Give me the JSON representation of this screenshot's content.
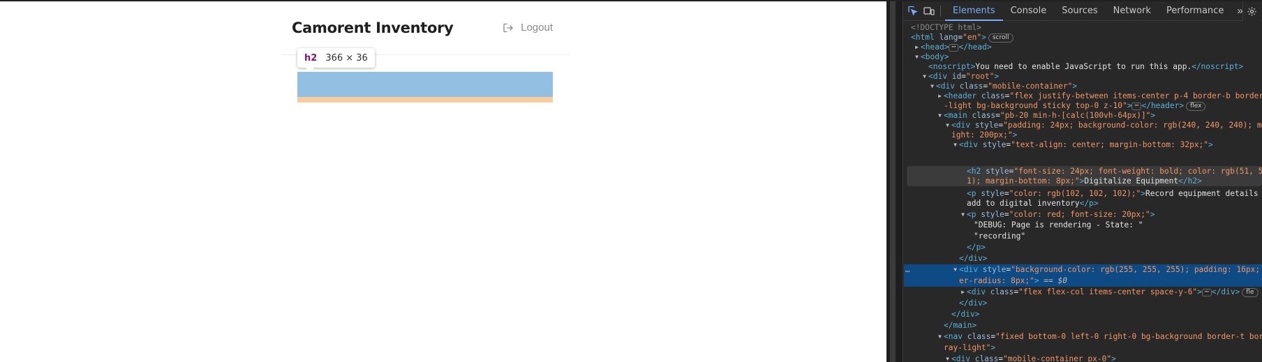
{
  "app": {
    "title": "Camorent Inventory",
    "logout_label": "Logout",
    "inspect_tooltip": {
      "tag": "h2",
      "size": "366 × 36"
    },
    "highlight_colors": {
      "content": "#93bfe3",
      "margin": "#f9cc9d"
    }
  },
  "devtools": {
    "tabs": [
      "Elements",
      "Console",
      "Sources",
      "Network",
      "Performance"
    ],
    "active_tab": "Elements",
    "more_tabs_icon": "chevron-double-right",
    "settings_icon": "gear",
    "selected_suffix": "== $0",
    "lines": {
      "l01": "<!DOCTYPE html>",
      "l02_tag": "<html",
      "l02_attr": "lang",
      "l02_val": "\"en\"",
      "l02_end": ">",
      "l02_badge": "scroll",
      "l03_open": "<head>",
      "l03_close": "</head>",
      "l04": "<body>",
      "l05_open": "<noscript>",
      "l05_text": "You need to enable JavaScript to run this app.",
      "l05_close": "</noscript>",
      "l06_tag": "<div",
      "l06_attr": "id",
      "l06_val": "\"root\"",
      "l07_tag": "<div",
      "l07_attr": "class",
      "l07_val": "\"mobile-container\"",
      "l08_tag": "<header",
      "l08_attr": "class",
      "l08_val_a": "\"flex justify-between items-center p-4 border-b border",
      "l08_val_b": "-light bg-background sticky top-0 z-10\"",
      "l08_close": "</header>",
      "l08_badge": "flex",
      "l09_tag": "<main",
      "l09_attr": "class",
      "l09_val": "\"pb-20 min-h-[calc(100vh-64px)]\"",
      "l10_tag": "<div",
      "l10_attr": "style",
      "l10_val_a": "\"padding: 24px; background-color: rgb(240, 240, 240); m",
      "l10_val_b": "ight: 200px;\"",
      "l11_tag": "<div",
      "l11_attr": "style",
      "l11_val": "\"text-align: center; margin-bottom: 32px;\"",
      "l12_tag": "<h2",
      "l12_attr": "style",
      "l12_val_a": "\"font-size: 24px; font-weight: bold; color: rgb(51, 5",
      "l12_val_b": "1); margin-bottom: 8px;\"",
      "l12_text": "Digitalize Equipment",
      "l12_close": "</h2>",
      "l13_tag": "<p",
      "l13_attr": "style",
      "l13_val": "\"color: rgb(102, 102, 102);\"",
      "l13_text_a": "Record equipment details",
      "l13_text_b": "add to digital inventory",
      "l13_close": "</p>",
      "l14_tag": "<p",
      "l14_attr": "style",
      "l14_val": "\"color: red; font-size: 20px;\"",
      "l15": "\"DEBUG: Page is rendering - State: \"",
      "l16": "\"recording\"",
      "l17": "</p>",
      "l18": "</div>",
      "l19_tag": "<div",
      "l19_attr": "style",
      "l19_val_a": "\"background-color: rgb(255, 255, 255); padding: 16px;",
      "l19_val_b": "er-radius: 8px;\"",
      "l20_tag": "<div",
      "l20_attr": "class",
      "l20_val": "\"flex flex-col items-center space-y-6\"",
      "l20_close": "</div>",
      "l20_badge": "fle",
      "l21": "</div>",
      "l22": "</div>",
      "l23": "</main>",
      "l24_tag": "<nav",
      "l24_attr": "class",
      "l24_val_a": "\"fixed bottom-0 left-0 right-0 bg-background border-t bor",
      "l24_val_b": "ray-light\"",
      "l25_tag": "<div",
      "l25_attr": "class",
      "l25_val": "\"mobile-container px-0\""
    }
  }
}
